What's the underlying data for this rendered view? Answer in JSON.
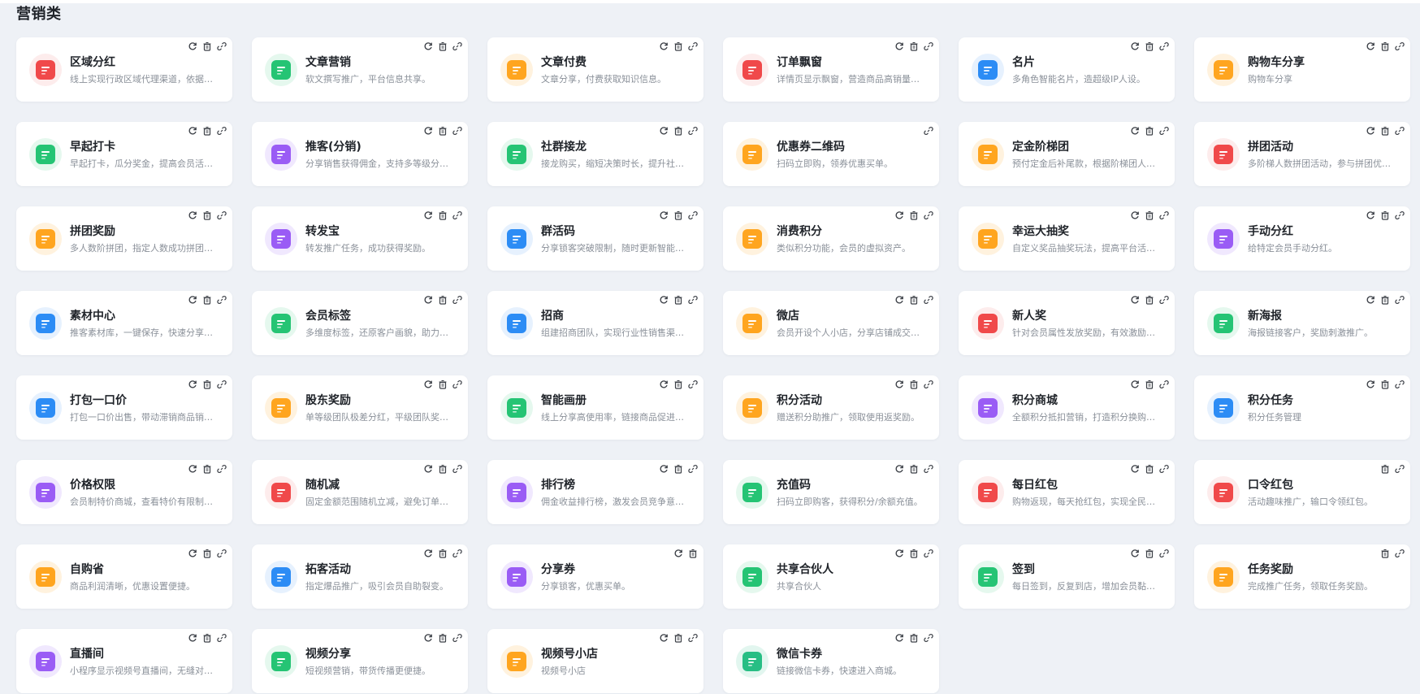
{
  "section_title": "营销类",
  "colors": {
    "red": "#f0494a",
    "green": "#25c474",
    "orange": "#ffa51f",
    "purple": "#9a5cf5",
    "blue": "#2c8cf5",
    "teal": "#27be84"
  },
  "cards": [
    {
      "title": "区域分红",
      "desc": "线上实现行政区域代理渠道，依据区域业绩分红。",
      "color": "red",
      "icon": "wallet-icon",
      "actions": [
        "refresh",
        "delete",
        "link"
      ]
    },
    {
      "title": "文章营销",
      "desc": "软文撰写推广，平台信息共享。",
      "color": "green",
      "icon": "article-icon",
      "actions": [
        "refresh",
        "delete",
        "link"
      ]
    },
    {
      "title": "文章付费",
      "desc": "文章分享，付费获取知识信息。",
      "color": "orange",
      "icon": "paid-article-icon",
      "actions": [
        "refresh",
        "delete",
        "link"
      ]
    },
    {
      "title": "订单飘窗",
      "desc": "详情页显示飘窗，营造商品高销量氛围。",
      "color": "red",
      "icon": "book-icon",
      "actions": [
        "refresh",
        "delete",
        "link"
      ]
    },
    {
      "title": "名片",
      "desc": "多角色智能名片，造超级IP人设。",
      "color": "blue",
      "icon": "card-icon",
      "actions": [
        "refresh",
        "delete",
        "link"
      ]
    },
    {
      "title": "购物车分享",
      "desc": "购物车分享",
      "color": "orange",
      "icon": "cart-icon",
      "actions": [
        "refresh",
        "delete",
        "link"
      ]
    },
    {
      "title": "早起打卡",
      "desc": "早起打卡，瓜分奖金，提高会员活跃度。",
      "color": "green",
      "icon": "clock-icon",
      "actions": [
        "refresh",
        "delete",
        "link"
      ]
    },
    {
      "title": "推客(分销)",
      "desc": "分享销售获得佣金，支持多等级分销。",
      "color": "purple",
      "icon": "user-icon",
      "actions": [
        "refresh",
        "delete",
        "link"
      ]
    },
    {
      "title": "社群接龙",
      "desc": "接龙购买，缩短决策时长，提升社群转化。",
      "color": "green",
      "icon": "group-icon",
      "actions": [
        "refresh",
        "delete",
        "link"
      ]
    },
    {
      "title": "优惠券二维码",
      "desc": "扫码立即购，领券优惠买单。",
      "color": "orange",
      "icon": "coupon-qr-icon",
      "actions": [
        "link"
      ]
    },
    {
      "title": "定金阶梯团",
      "desc": "预付定金后补尾款，根据阶梯团人数优惠。",
      "color": "orange",
      "icon": "deposit-icon",
      "actions": [
        "refresh",
        "delete",
        "link"
      ]
    },
    {
      "title": "拼团活动",
      "desc": "多阶梯人数拼团活动，参与拼团优惠更多。",
      "color": "red",
      "icon": "group-buy-icon",
      "actions": [
        "refresh",
        "delete",
        "link"
      ]
    },
    {
      "title": "拼团奖励",
      "desc": "多人数阶拼团，指定人数成功拼团可得奖励。",
      "color": "orange",
      "icon": "trophy-icon",
      "actions": [
        "refresh",
        "delete",
        "link"
      ]
    },
    {
      "title": "转发宝",
      "desc": "转发推广任务，成功获得奖励。",
      "color": "purple",
      "icon": "share-icon",
      "actions": [
        "refresh",
        "delete",
        "link"
      ]
    },
    {
      "title": "群活码",
      "desc": "分享锁客突破限制，随时更新智能推送。",
      "color": "blue",
      "icon": "qrcode-icon",
      "actions": [
        "refresh",
        "delete",
        "link"
      ]
    },
    {
      "title": "消费积分",
      "desc": "类似积分功能，会员的虚拟资产。",
      "color": "orange",
      "icon": "coins-icon",
      "actions": [
        "refresh",
        "delete",
        "link"
      ]
    },
    {
      "title": "幸运大抽奖",
      "desc": "自定义奖品抽奖玩法，提高平台活跃度。",
      "color": "orange",
      "icon": "wheel-icon",
      "actions": [
        "refresh",
        "delete",
        "link"
      ]
    },
    {
      "title": "手动分红",
      "desc": "给特定会员手动分红。",
      "color": "purple",
      "icon": "hand-coin-icon",
      "actions": [
        "refresh",
        "delete",
        "link"
      ]
    },
    {
      "title": "素材中心",
      "desc": "推客素材库，一键保存，快速分享推广。",
      "color": "blue",
      "icon": "layers-icon",
      "actions": [
        "refresh",
        "delete",
        "link"
      ]
    },
    {
      "title": "会员标签",
      "desc": "多维度标签，还原客户画貌，助力精准营销。",
      "color": "green",
      "icon": "member-tag-icon",
      "actions": [
        "refresh",
        "delete",
        "link"
      ]
    },
    {
      "title": "招商",
      "desc": "组建招商团队，实现行业性销售渠道拓展。",
      "color": "blue",
      "icon": "building-icon",
      "actions": [
        "refresh",
        "delete",
        "link"
      ]
    },
    {
      "title": "微店",
      "desc": "会员开设个人小店，分享店铺成交获得佣金。",
      "color": "orange",
      "icon": "shop-icon",
      "actions": [
        "refresh",
        "delete",
        "link"
      ]
    },
    {
      "title": "新人奖",
      "desc": "针对会员属性发放奖励，有效激励新会员。",
      "color": "red",
      "icon": "medal-icon",
      "actions": [
        "refresh",
        "delete",
        "link"
      ]
    },
    {
      "title": "新海报",
      "desc": "海报链接客户，奖励刺激推广。",
      "color": "green",
      "icon": "poster-icon",
      "actions": [
        "refresh",
        "delete",
        "link"
      ]
    },
    {
      "title": "打包一口价",
      "desc": "打包一口价出售，带动滞销商品销售。",
      "color": "blue",
      "icon": "package-icon",
      "actions": [
        "refresh",
        "delete",
        "link"
      ]
    },
    {
      "title": "股东奖励",
      "desc": "单等级团队极差分红，平级团队奖励。",
      "color": "orange",
      "icon": "team-icon",
      "actions": [
        "refresh",
        "delete",
        "link"
      ]
    },
    {
      "title": "智能画册",
      "desc": "线上分享高使用率，链接商品促进销售。",
      "color": "green",
      "icon": "album-icon",
      "actions": [
        "refresh",
        "delete",
        "link"
      ]
    },
    {
      "title": "积分活动",
      "desc": "赠送积分助推广，领取使用返奖励。",
      "color": "orange",
      "icon": "star-icon",
      "actions": [
        "refresh",
        "delete",
        "link"
      ]
    },
    {
      "title": "积分商城",
      "desc": "全额积分抵扣营销，打造积分换购商城。",
      "color": "purple",
      "icon": "store-icon",
      "actions": [
        "refresh",
        "delete",
        "link"
      ]
    },
    {
      "title": "积分任务",
      "desc": "积分任务管理",
      "color": "blue",
      "icon": "task-list-icon",
      "actions": [
        "refresh",
        "delete",
        "link"
      ]
    },
    {
      "title": "价格权限",
      "desc": "会员制特价商城，查看特价有限制门槛。",
      "color": "purple",
      "icon": "lock-icon",
      "actions": [
        "refresh",
        "delete",
        "link"
      ]
    },
    {
      "title": "随机减",
      "desc": "固定金额范围随机立减，避免订单流失。",
      "color": "red",
      "icon": "shuffle-icon",
      "actions": [
        "refresh",
        "delete",
        "link"
      ]
    },
    {
      "title": "排行榜",
      "desc": "佣金收益排行榜，激发会员竞争意识。",
      "color": "purple",
      "icon": "ranking-icon",
      "actions": [
        "refresh",
        "delete",
        "link"
      ]
    },
    {
      "title": "充值码",
      "desc": "扫码立即购客，获得积分/余额充值。",
      "color": "green",
      "icon": "recharge-icon",
      "actions": [
        "refresh",
        "delete",
        "link"
      ]
    },
    {
      "title": "每日红包",
      "desc": "购物返现，每天抢红包，实现全民营销。",
      "color": "red",
      "icon": "red-packet-icon",
      "actions": [
        "refresh",
        "delete",
        "link"
      ]
    },
    {
      "title": "口令红包",
      "desc": "活动趣味推广，输口令领红包。",
      "color": "red",
      "icon": "password-packet-icon",
      "actions": [
        "delete",
        "link"
      ]
    },
    {
      "title": "自购省",
      "desc": "商品利润清晰，优惠设置便捷。",
      "color": "orange",
      "icon": "discount-bag-icon",
      "actions": [
        "refresh",
        "delete",
        "link"
      ]
    },
    {
      "title": "拓客活动",
      "desc": "指定爆品推广，吸引会员自助裂变。",
      "color": "blue",
      "icon": "expand-icon",
      "actions": [
        "refresh",
        "delete",
        "link"
      ]
    },
    {
      "title": "分享券",
      "desc": "分享锁客，优惠买单。",
      "color": "purple",
      "icon": "share-coupon-icon",
      "actions": [
        "refresh",
        "delete"
      ]
    },
    {
      "title": "共享合伙人",
      "desc": "共享合伙人",
      "color": "green",
      "icon": "partner-icon",
      "actions": [
        "refresh",
        "delete",
        "link"
      ]
    },
    {
      "title": "签到",
      "desc": "每日签到，反复到店，增加会员黏性。",
      "color": "green",
      "icon": "calendar-check-icon",
      "actions": [
        "refresh",
        "delete",
        "link"
      ]
    },
    {
      "title": "任务奖励",
      "desc": "完成推广任务，领取任务奖励。",
      "color": "orange",
      "icon": "reward-icon",
      "actions": [
        "delete",
        "link"
      ]
    },
    {
      "title": "直播间",
      "desc": "小程序显示视频号直播间，无缝对接。",
      "color": "purple",
      "icon": "live-tv-icon",
      "actions": [
        "refresh",
        "delete",
        "link"
      ]
    },
    {
      "title": "视频分享",
      "desc": "短视频营销，带货传播更便捷。",
      "color": "green",
      "icon": "video-share-icon",
      "actions": [
        "refresh",
        "delete",
        "link"
      ]
    },
    {
      "title": "视频号小店",
      "desc": "视频号小店",
      "color": "orange",
      "icon": "bag-icon",
      "actions": [
        "refresh",
        "delete",
        "link"
      ]
    },
    {
      "title": "微信卡券",
      "desc": "链接微信卡券，快速进入商城。",
      "color": "teal",
      "icon": "wechat-card-icon",
      "actions": [
        "refresh",
        "delete",
        "link"
      ]
    }
  ]
}
